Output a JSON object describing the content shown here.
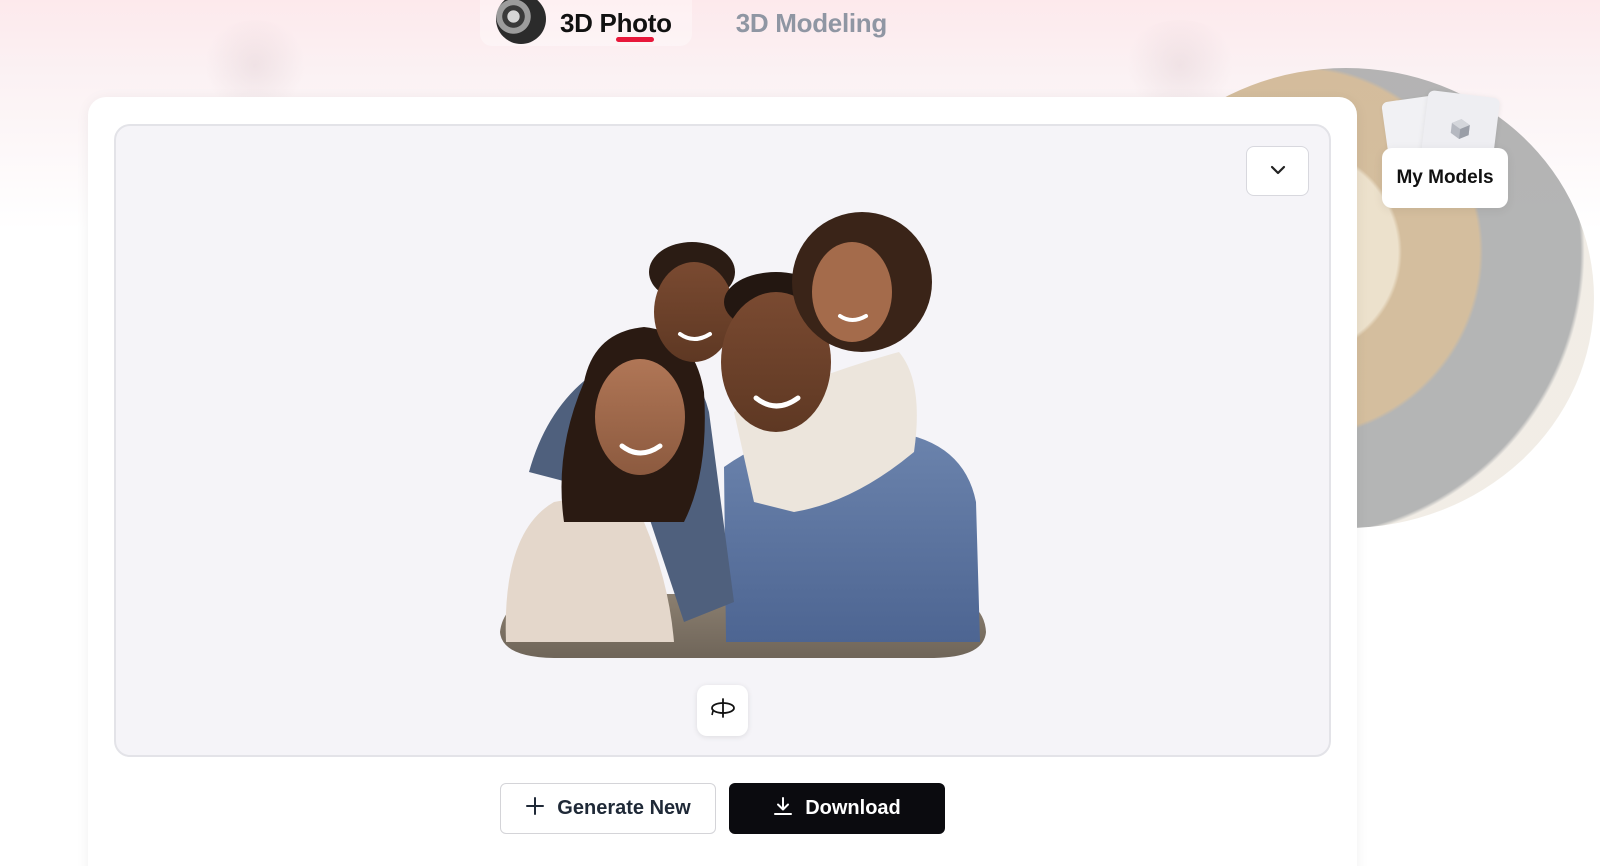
{
  "tabs": [
    {
      "label": "3D Photo",
      "active": true,
      "thumb_icon": "family-portrait-thumbnail"
    },
    {
      "label": "3D Modeling",
      "active": false,
      "thumb_icon": "bust-sculpture-thumbnail"
    }
  ],
  "viewer": {
    "collapse_icon": "chevron-down-icon",
    "rotate_icon": "rotate-360-icon",
    "model_alt": "3D family portrait model"
  },
  "actions": {
    "generate_label": "Generate New",
    "download_label": "Download"
  },
  "side": {
    "my_models_label": "My Models",
    "icon": "cube-icon"
  },
  "colors": {
    "accent": "#e8173a",
    "primary_button": "#0b0b0f",
    "inactive_tab": "#8f96a3"
  }
}
